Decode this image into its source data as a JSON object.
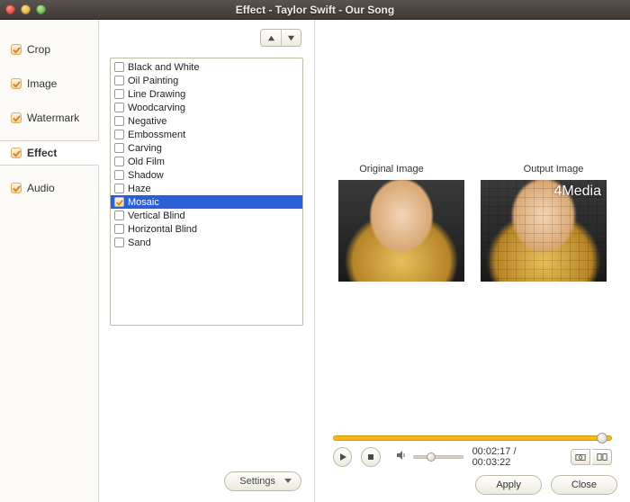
{
  "window": {
    "title": "Effect - Taylor Swift - Our Song"
  },
  "sidebar": {
    "items": [
      {
        "label": "Crop",
        "key": "crop"
      },
      {
        "label": "Image",
        "key": "image"
      },
      {
        "label": "Watermark",
        "key": "watermark"
      },
      {
        "label": "Effect",
        "key": "effect"
      },
      {
        "label": "Audio",
        "key": "audio"
      }
    ],
    "active": "effect"
  },
  "effects": {
    "list": [
      {
        "label": "Black and White",
        "checked": false,
        "selected": false
      },
      {
        "label": "Oil Painting",
        "checked": false,
        "selected": false
      },
      {
        "label": "Line Drawing",
        "checked": false,
        "selected": false
      },
      {
        "label": "Woodcarving",
        "checked": false,
        "selected": false
      },
      {
        "label": "Negative",
        "checked": false,
        "selected": false
      },
      {
        "label": "Embossment",
        "checked": false,
        "selected": false
      },
      {
        "label": "Carving",
        "checked": false,
        "selected": false
      },
      {
        "label": "Old Film",
        "checked": false,
        "selected": false
      },
      {
        "label": "Shadow",
        "checked": false,
        "selected": false
      },
      {
        "label": "Haze",
        "checked": false,
        "selected": false
      },
      {
        "label": "Mosaic",
        "checked": true,
        "selected": true
      },
      {
        "label": "Vertical Blind",
        "checked": false,
        "selected": false
      },
      {
        "label": "Horizontal Blind",
        "checked": false,
        "selected": false
      },
      {
        "label": "Sand",
        "checked": false,
        "selected": false
      }
    ]
  },
  "preview": {
    "original_label": "Original Image",
    "output_label": "Output Image",
    "watermark": "4Media"
  },
  "playback": {
    "current": "00:02:17",
    "total": "00:03:22",
    "separator": " / "
  },
  "buttons": {
    "settings": "Settings",
    "apply": "Apply",
    "close": "Close"
  }
}
